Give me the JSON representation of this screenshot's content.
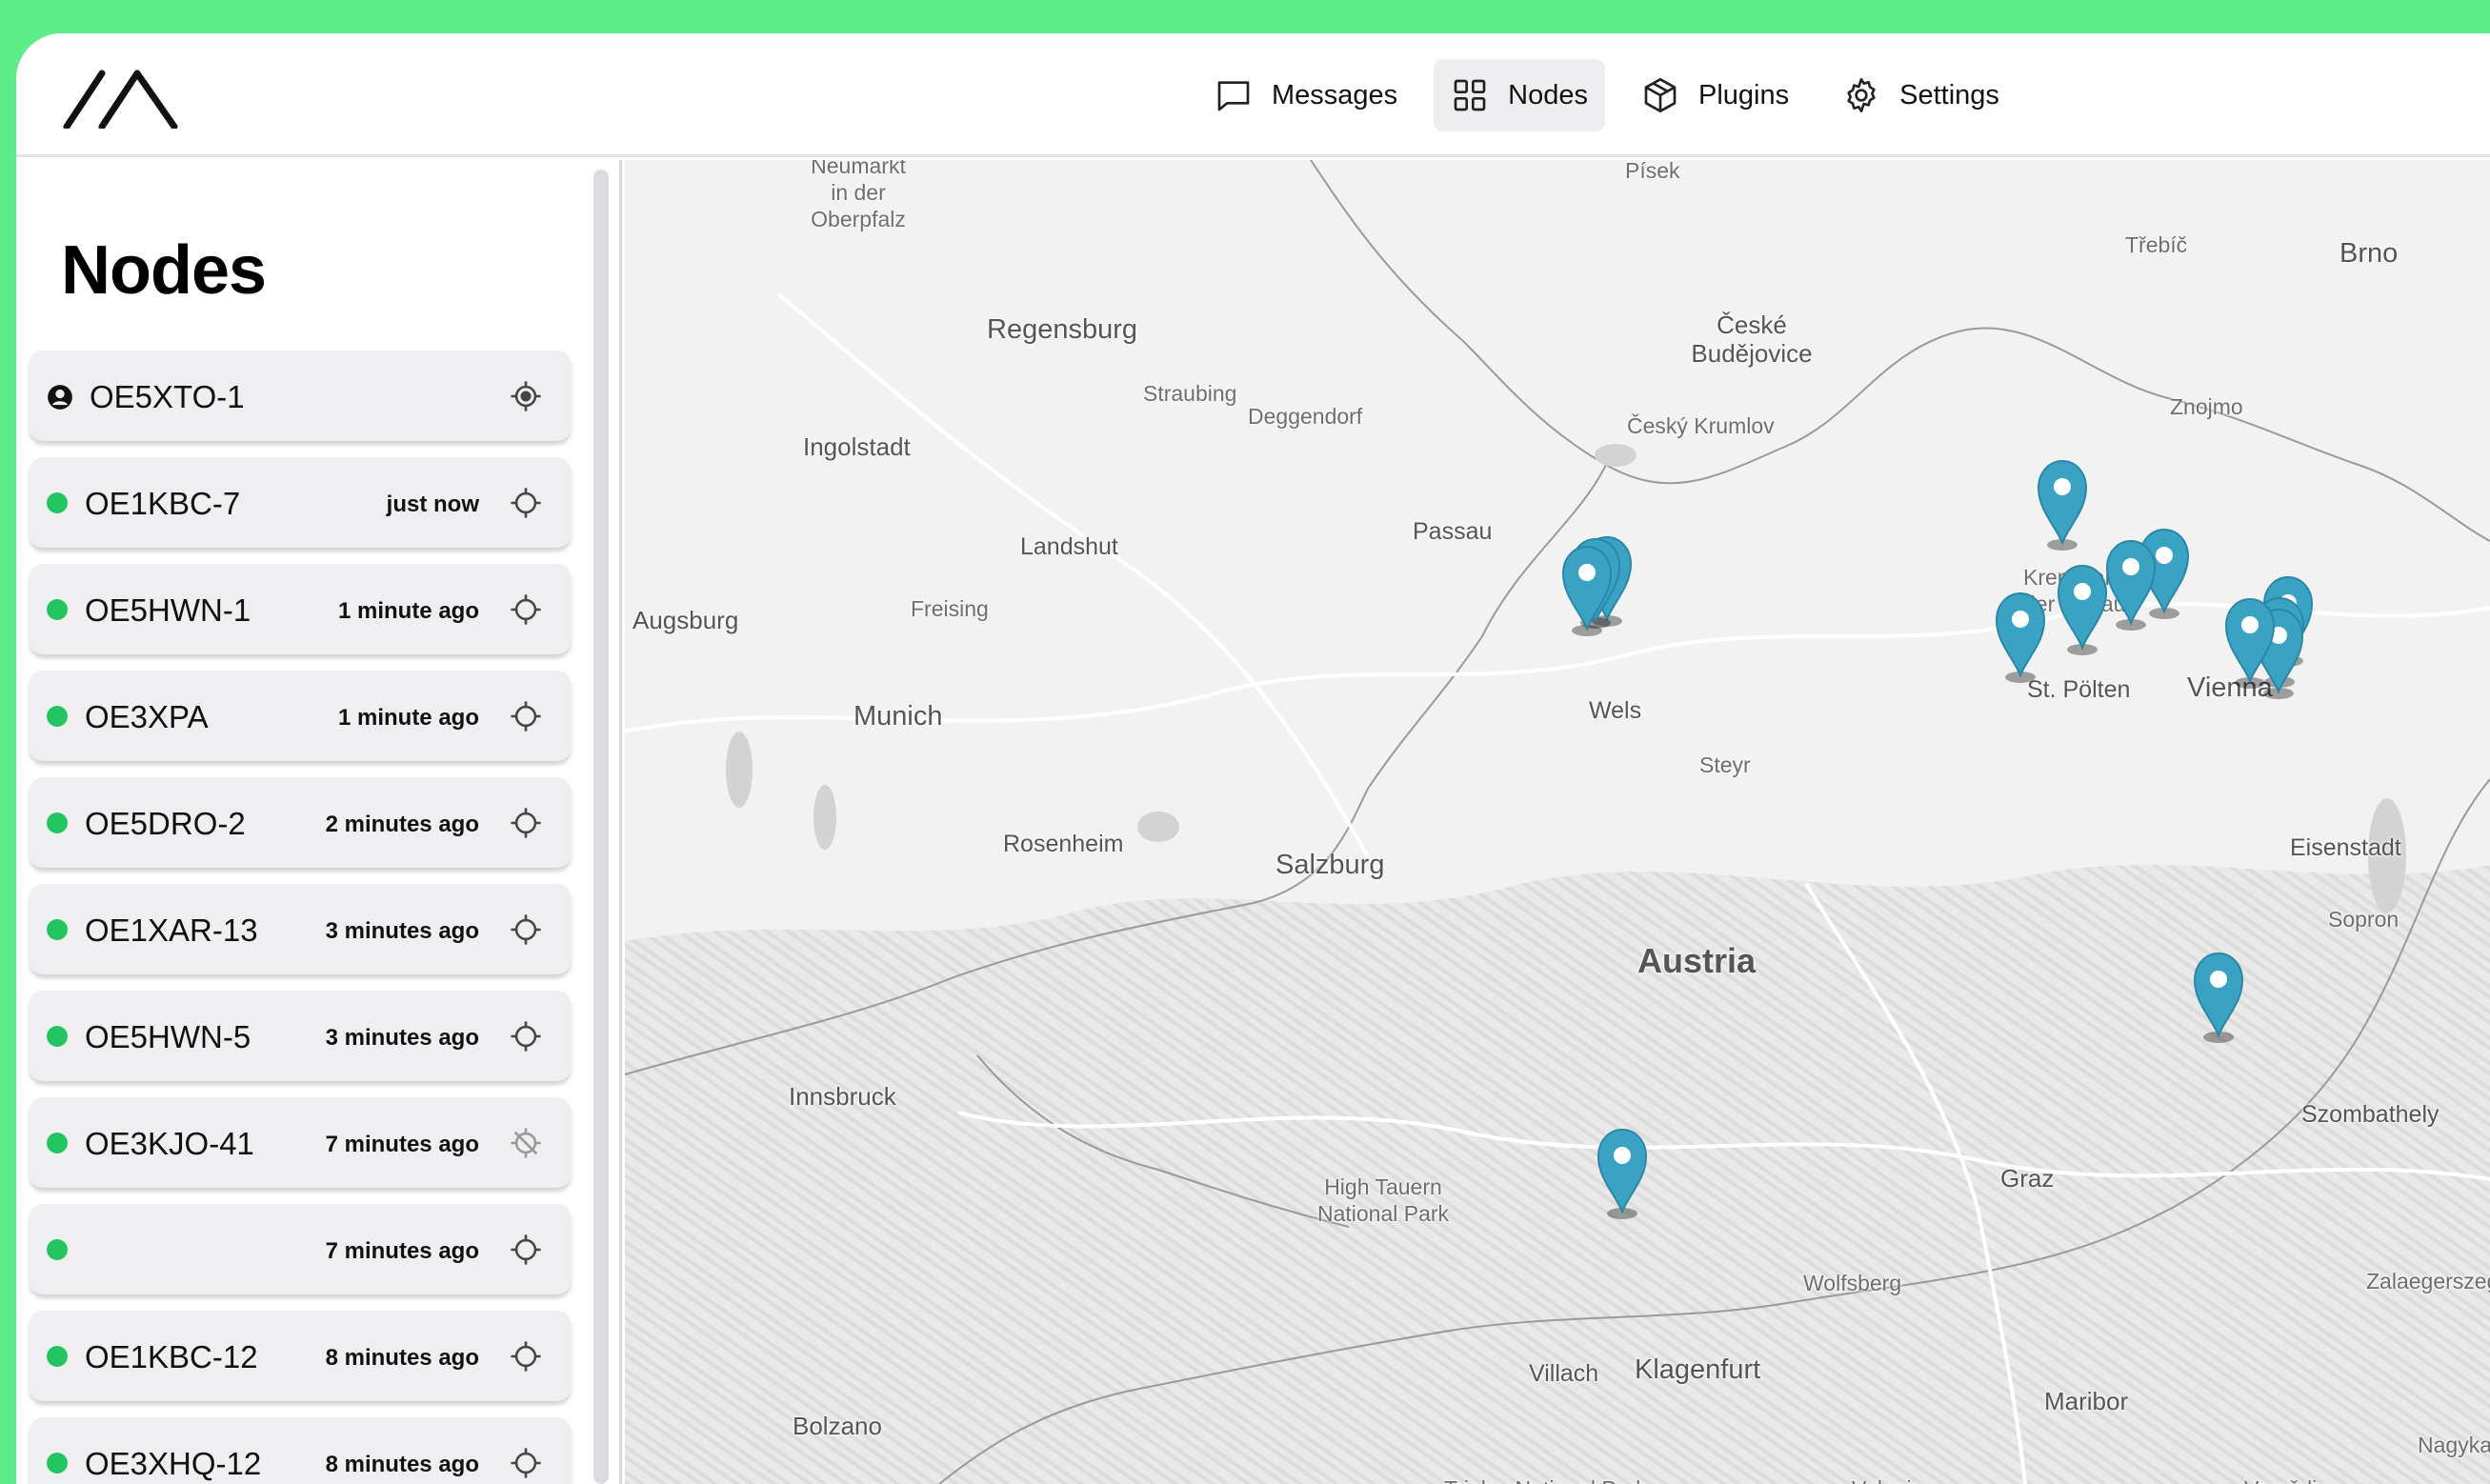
{
  "nav": {
    "items": [
      {
        "label": "Messages",
        "icon": "message-square-icon",
        "active": false
      },
      {
        "label": "Nodes",
        "icon": "grid-icon",
        "active": true
      },
      {
        "label": "Plugins",
        "icon": "package-icon",
        "active": false
      },
      {
        "label": "Settings",
        "icon": "gear-icon",
        "active": false
      }
    ]
  },
  "sidebar": {
    "title": "Nodes",
    "nodes": [
      {
        "name": "OE5XTO-1",
        "time": "",
        "own": true
      },
      {
        "name": "OE1KBC-7",
        "time": "just now"
      },
      {
        "name": "OE5HWN-1",
        "time": "1 minute ago"
      },
      {
        "name": "OE3XPA",
        "time": "1 minute ago"
      },
      {
        "name": "OE5DRO-2",
        "time": "2 minutes ago"
      },
      {
        "name": "OE1XAR-13",
        "time": "3 minutes ago"
      },
      {
        "name": "OE5HWN-5",
        "time": "3 minutes ago"
      },
      {
        "name": "OE3KJO-41",
        "time": "7 minutes ago",
        "no_position": true
      },
      {
        "name": "",
        "time": "7 minutes ago"
      },
      {
        "name": "OE1KBC-12",
        "time": "8 minutes ago"
      },
      {
        "name": "OE3XHQ-12",
        "time": "8 minutes ago"
      }
    ]
  },
  "map": {
    "places": {
      "neumarkt": "Neumarkt in der Oberpfalz",
      "pisek": "Písek",
      "trebic": "Třebíč",
      "brno": "Brno",
      "regensburg": "Regensburg",
      "ceske": "České Budějovice",
      "straubing": "Straubing",
      "deggendorf": "Deggendorf",
      "znojmo": "Znojmo",
      "ingolstadt": "Ingolstadt",
      "krumlov": "Český Krumlov",
      "landshut": "Landshut",
      "passau": "Passau",
      "krems": "Krems an der Donau",
      "augsburg": "Augsburg",
      "freising": "Freising",
      "stpolten": "St. Pölten",
      "vienna": "Vienna",
      "munich": "Munich",
      "wels": "Wels",
      "steyr": "Steyr",
      "rosenheim": "Rosenheim",
      "salzburg": "Salzburg",
      "eisenstadt": "Eisenstadt",
      "sopron": "Sopron",
      "austria": "Austria",
      "innsbruck": "Innsbruck",
      "szombathely": "Szombathely",
      "hightauern": "High Tauern National Park",
      "graz": "Graz",
      "zalaegerszeg": "Zalaegerszeg",
      "wolfsberg": "Wolfsberg",
      "villach": "Villach",
      "klagenfurt": "Klagenfurt",
      "bolzano": "Bolzano",
      "maribor": "Maribor",
      "nagykan": "Nagykan",
      "velenje": "Velenje",
      "triglav": "Triglav National Park",
      "varazdin": "Varaždin"
    }
  },
  "colors": {
    "accent_bar": "#5ded88",
    "online_dot": "#22c55e",
    "marker": "#3aa3c4"
  }
}
